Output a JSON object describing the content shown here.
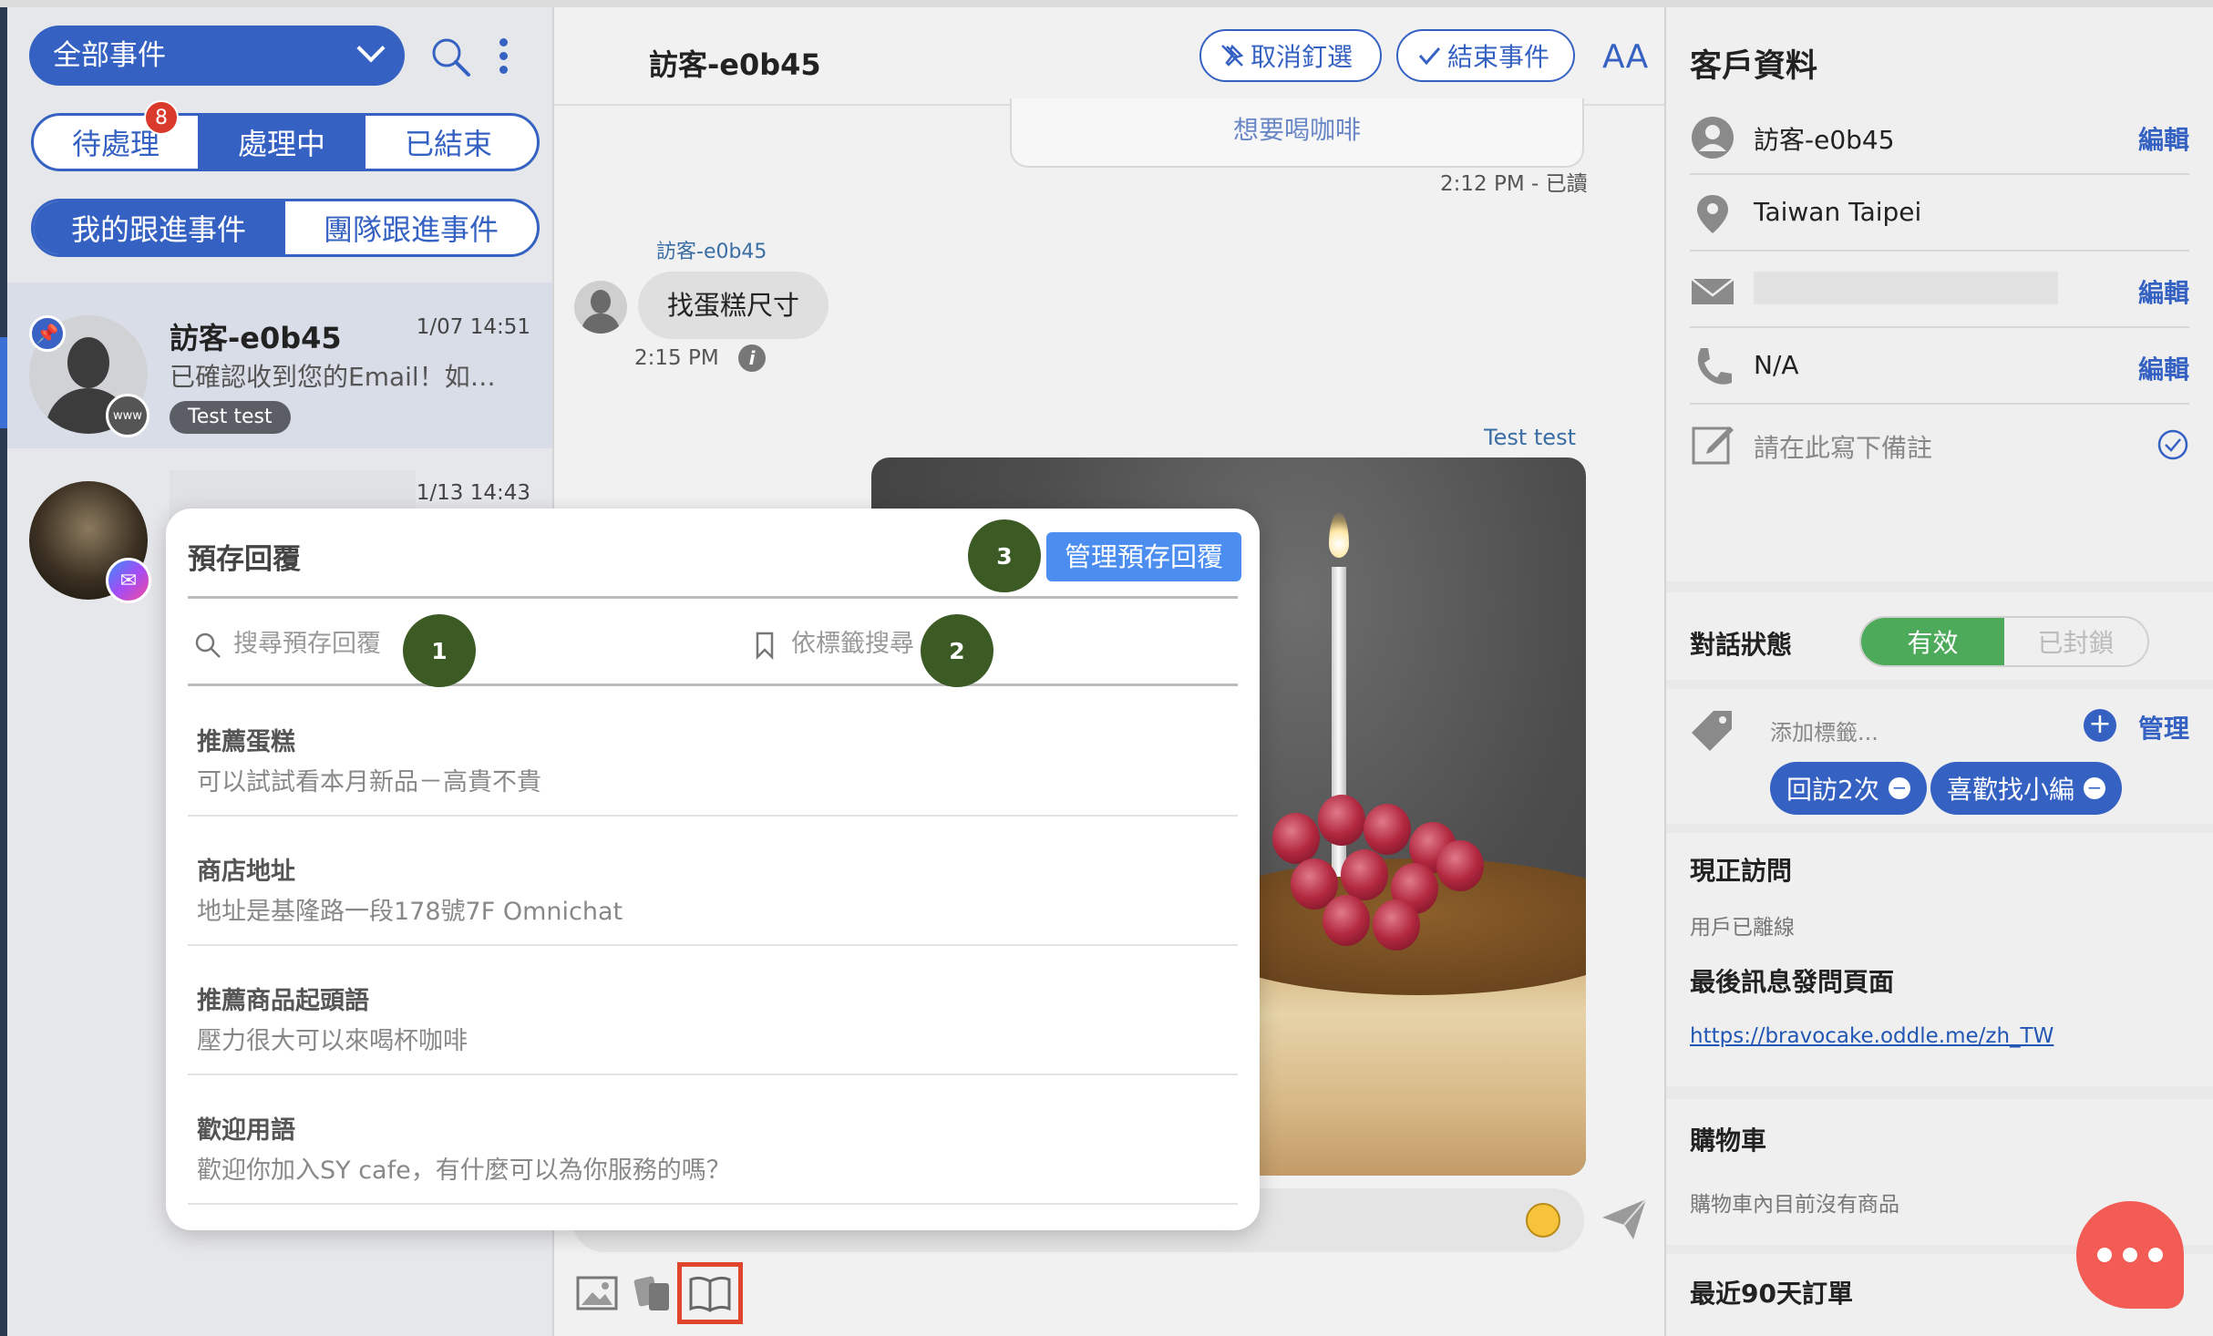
{
  "left": {
    "filter_label": "全部事件",
    "status_tabs": [
      "待處理",
      "處理中",
      "已結束"
    ],
    "status_badge": "8",
    "scope_tabs": [
      "我的跟進事件",
      "團隊跟進事件"
    ],
    "conversations": [
      {
        "name": "訪客-e0b45",
        "time": "1/07 14:51",
        "preview": "已確認收到您的Email！如果您有任何問題請隨時告知",
        "tag": "Test test",
        "source": "www"
      },
      {
        "name": "",
        "time": "1/13 14:43",
        "preview": "",
        "tag": "",
        "source": "messenger"
      }
    ]
  },
  "chat": {
    "title": "訪客-e0b45",
    "unpin_label": "取消釘選",
    "end_label": "結束事件",
    "font_size_label": "AA",
    "prev_message": "想要喝咖啡",
    "prev_read": "2:12 PM - 已讀",
    "visitor_name": "訪客-e0b45",
    "visitor_message": "找蛋糕尺寸",
    "visitor_time": "2:15 PM",
    "agent_name": "Test test"
  },
  "modal": {
    "title": "預存回覆",
    "manage_label": "管理預存回覆",
    "search_placeholder": "搜尋預存回覆",
    "tag_search_label": "依標籤搜尋",
    "steps": [
      "1",
      "2",
      "3"
    ],
    "items": [
      {
        "title": "推薦蛋糕",
        "desc": "可以試試看本月新品－高貴不貴"
      },
      {
        "title": "商店地址",
        "desc": "地址是基隆路一段178號7F Omnichat"
      },
      {
        "title": "推薦商品起頭語",
        "desc": "壓力很大可以來喝杯咖啡"
      },
      {
        "title": "歡迎用語",
        "desc": "歡迎你加入SY cafe，有什麼可以為你服務的嗎？"
      }
    ]
  },
  "customer": {
    "title": "客戶資料",
    "name": "訪客-e0b45",
    "location": "Taiwan Taipei",
    "phone": "N/A",
    "note_placeholder": "請在此寫下備註",
    "edit_label": "編輯",
    "status_label": "對話狀態",
    "status_on": "有效",
    "status_off": "已封鎖",
    "tag_placeholder": "添加標籤...",
    "manage_label": "管理",
    "tags": [
      "回訪2次",
      "喜歡找小編"
    ],
    "current_visit_title": "現正訪問",
    "current_visit_value": "用戶已離線",
    "last_page_title": "最後訊息發問頁面",
    "last_page_url": "https://bravocake.oddle.me/zh_TW",
    "cart_title": "購物車",
    "cart_value": "購物車內目前沒有商品",
    "orders_title": "最近90天訂單"
  },
  "colors": {
    "brand_blue": "#3562c2",
    "status_green": "#4caa5a",
    "badge_red": "#d93a2b",
    "fab_red": "#f25c54",
    "step_green": "#3b5a24",
    "highlight": "#e2452d"
  }
}
